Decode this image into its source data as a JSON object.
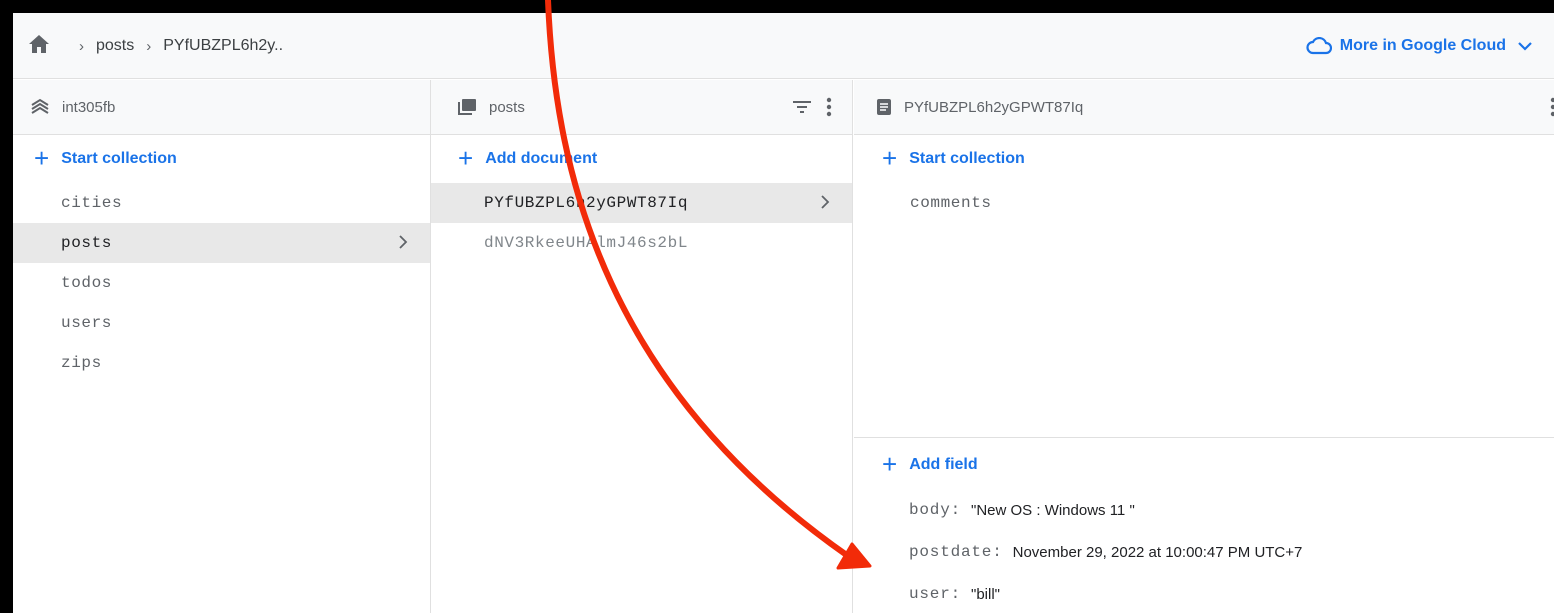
{
  "breadcrumb": {
    "items": [
      "posts",
      "PYfUBZPL6h2y.."
    ]
  },
  "cloud_link": {
    "label": "More in Google Cloud"
  },
  "columns": {
    "root": {
      "title": "int305fb",
      "action": "Start collection",
      "items": [
        "cities",
        "posts",
        "todos",
        "users",
        "zips"
      ],
      "selected": "posts"
    },
    "collection": {
      "title": "posts",
      "action": "Add document",
      "items": [
        "PYfUBZPL6h2yGPWT87Iq",
        "dNV3RkeeUHAlmJ46s2bL"
      ],
      "selected": "PYfUBZPL6h2yGPWT87Iq"
    },
    "document": {
      "title": "PYfUBZPL6h2yGPWT87Iq",
      "action": "Start collection",
      "items": [
        "comments"
      ],
      "fields_action": "Add field",
      "fields": [
        {
          "key": "body:",
          "value": "\"New OS : Windows 11 \""
        },
        {
          "key": "postdate:",
          "value": "November 29, 2022 at 10:00:47 PM UTC+7"
        },
        {
          "key": "user:",
          "value": "\"bill\""
        }
      ]
    }
  },
  "colors": {
    "accent": "#1a73e8",
    "annotation_arrow": "#f22b09",
    "selected_row": "#e8e8e8"
  },
  "icons": [
    "home-icon",
    "chevron-right-icon",
    "cloud-icon",
    "chevron-down-icon",
    "database-icon",
    "collection-icon",
    "filter-icon",
    "more-vert-icon",
    "document-icon",
    "plus-icon"
  ]
}
